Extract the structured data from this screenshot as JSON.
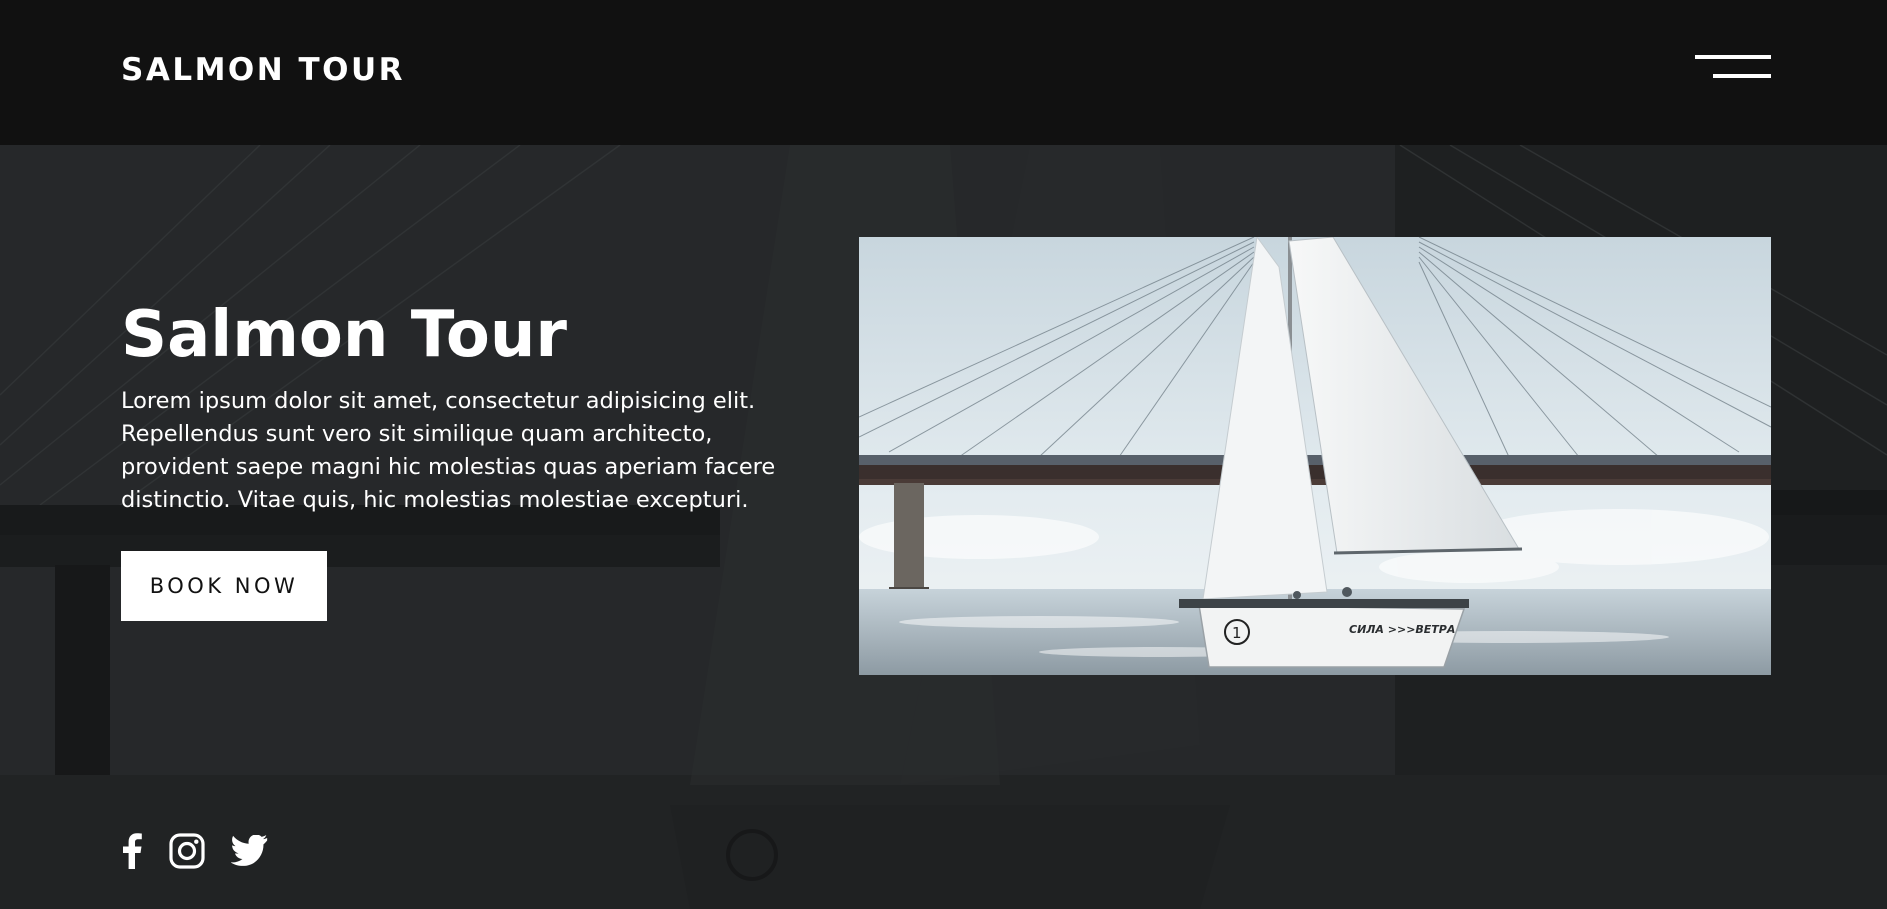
{
  "header": {
    "brand": "SALMON TOUR",
    "menu_icon": "hamburger-menu-icon"
  },
  "hero": {
    "title": "Salmon Tour",
    "description": "Lorem ipsum dolor sit amet, consectetur adipisicing elit. Repellendus sunt vero sit similique quam architecto, provident saepe magni hic molestias quas aperiam facere distinctio. Vitae quis, hic molestias molestiae excepturi.",
    "cta_label": "BOOK NOW",
    "image": {
      "subject": "sailboat-under-cable-stayed-bridge",
      "boat_number": "1",
      "boat_name": "СИЛА >>>ВЕТРА"
    }
  },
  "social": [
    {
      "name": "facebook",
      "icon": "facebook-icon"
    },
    {
      "name": "instagram",
      "icon": "instagram-icon"
    },
    {
      "name": "twitter",
      "icon": "twitter-icon"
    }
  ],
  "colors": {
    "header_bg": "#111111",
    "hero_overlay": "#262829",
    "text": "#ffffff",
    "button_bg": "#ffffff",
    "button_text": "#111111"
  }
}
